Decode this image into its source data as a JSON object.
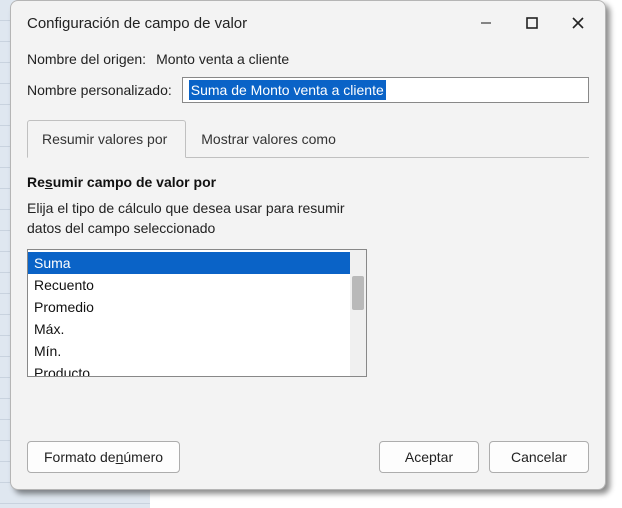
{
  "window": {
    "title": "Configuración de campo de valor"
  },
  "source": {
    "label": "Nombre del origen:",
    "value": "Monto venta a cliente"
  },
  "custom": {
    "label": "Nombre personalizado:",
    "value": "Suma de Monto venta a cliente"
  },
  "tabs": {
    "summarize": "Resumir valores por",
    "show_as": "Mostrar valores como"
  },
  "section": {
    "heading_pre": "Re",
    "heading_ul": "s",
    "heading_post": "umir campo de valor por",
    "desc_line1": "Elija el tipo de cálculo que desea usar para resumir",
    "desc_line2": "datos del campo seleccionado"
  },
  "list": {
    "items": [
      "Suma",
      "Recuento",
      "Promedio",
      "Máx.",
      "Mín.",
      "Producto"
    ],
    "selected_index": 0
  },
  "buttons": {
    "number_format_pre": "Formato de ",
    "number_format_ul": "n",
    "number_format_post": "úmero",
    "ok": "Aceptar",
    "cancel": "Cancelar"
  },
  "icons": {
    "minimize": "minimize-icon",
    "maximize": "maximize-icon",
    "close": "close-icon"
  }
}
